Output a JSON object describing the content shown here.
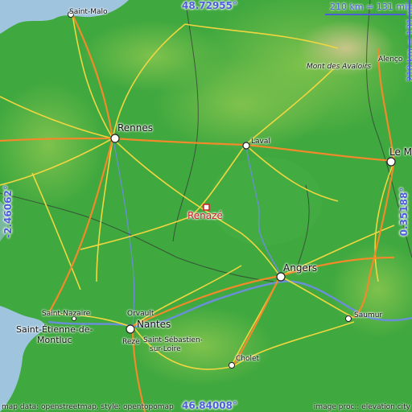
{
  "map": {
    "place": "Renazé",
    "marker_color": "#d32027",
    "coord_color": "#4a5fd8",
    "lat_top": "48.72955°",
    "lat_bottom": "46.84008°",
    "lon_left": "-2.46062°",
    "lon_right": "0.35188°",
    "scale_top": "210 km = 131 mi",
    "scale_right": "210 km = 131 mi",
    "credit_left": "map data: openstreetmap, style: opentopomap",
    "credit_right": "image proc.: elevation.city",
    "cities": {
      "saint_malo": "Saint-Malo",
      "rennes": "Rennes",
      "laval": "Laval",
      "le_mans": "Le M",
      "alencon": "Alenço",
      "mont_des_avaloirs": "Mont des Avaloirs",
      "angers": "Angers",
      "saumur": "Saumur",
      "cholet": "Cholet",
      "saint_nazaire": "Saint-Nazaire",
      "saint_etienne_1": "Saint-Étienne-de-",
      "saint_etienne_2": "Montluc",
      "orvault": "Orvault",
      "nantes": "Nantes",
      "reze": "Rezé",
      "saint_sebastien_1": "Saint-Sébastien-",
      "saint_sebastien_2": "sur-Loire"
    }
  }
}
